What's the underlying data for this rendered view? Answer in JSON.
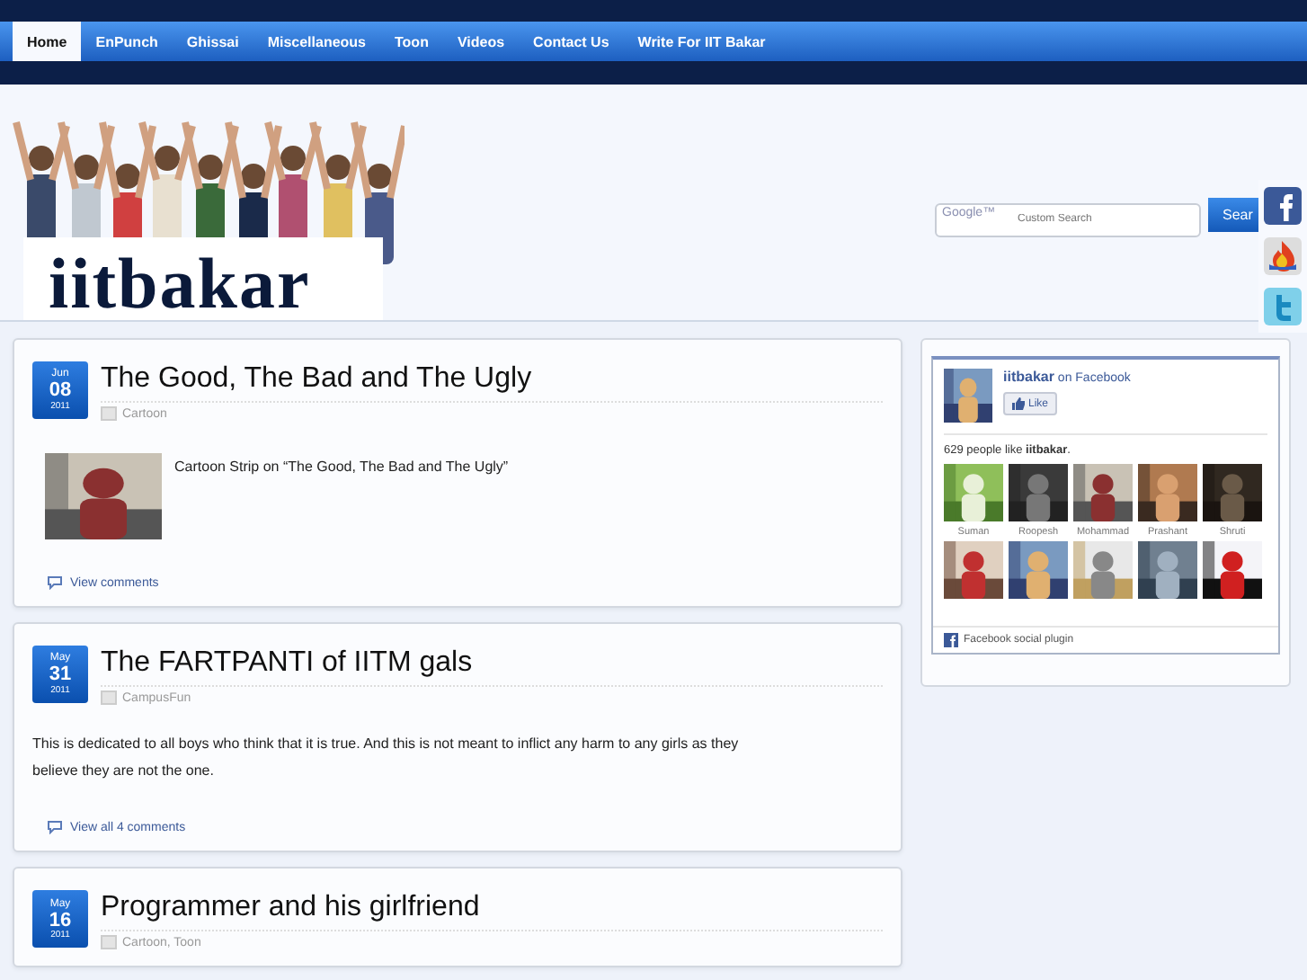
{
  "nav": {
    "items": [
      {
        "label": "Home",
        "selected": true
      },
      {
        "label": "EnPunch",
        "selected": false
      },
      {
        "label": "Ghissai",
        "selected": false
      },
      {
        "label": "Miscellaneous",
        "selected": false
      },
      {
        "label": "Toon",
        "selected": false
      },
      {
        "label": "Videos",
        "selected": false
      },
      {
        "label": "Contact Us",
        "selected": false
      },
      {
        "label": "Write For IIT Bakar",
        "selected": false
      }
    ]
  },
  "header": {
    "logo_text": "iitbakar",
    "search": {
      "placeholder": "Custom Search",
      "brand": "Google™"
    },
    "search_button": "Sear"
  },
  "posts": [
    {
      "month": "Jun",
      "day": "08",
      "year": "2011",
      "title": "The Good, The Bad and The Ugly",
      "categories": "Cartoon",
      "thumbnail": {
        "kind": "picture"
      },
      "excerpt": "Cartoon Strip on “The Good, The Bad and The Ugly”",
      "comments_link": "View comments"
    },
    {
      "month": "May",
      "day": "31",
      "year": "2011",
      "title": "The FARTPANTI of IITM gals",
      "categories": "CampusFun",
      "excerpt": "This is dedicated to all boys who think that it is true. And this is not meant to inflict any harm to any girls as they believe they are not the one.",
      "comments_link": "View all 4 comments"
    },
    {
      "month": "May",
      "day": "16",
      "year": "2011",
      "title": "Programmer and his girlfriend",
      "categories": "Cartoon, Toon"
    }
  ],
  "facebook": {
    "page_name": "iitbakar",
    "on_text": "on Facebook",
    "like_button": "Like",
    "count_text": "629 people like **iitbakar**.",
    "fans": [
      {
        "name": "Suman"
      },
      {
        "name": "Roopesh"
      },
      {
        "name": "Mohammad"
      },
      {
        "name": "Prashant"
      },
      {
        "name": "Shruti"
      },
      {
        "kind": "picture"
      },
      {
        "kind": "picture"
      },
      {
        "kind": "picture"
      },
      {
        "kind": "picture"
      },
      {
        "kind": "picture"
      }
    ],
    "footer": "Facebook social plugin"
  }
}
